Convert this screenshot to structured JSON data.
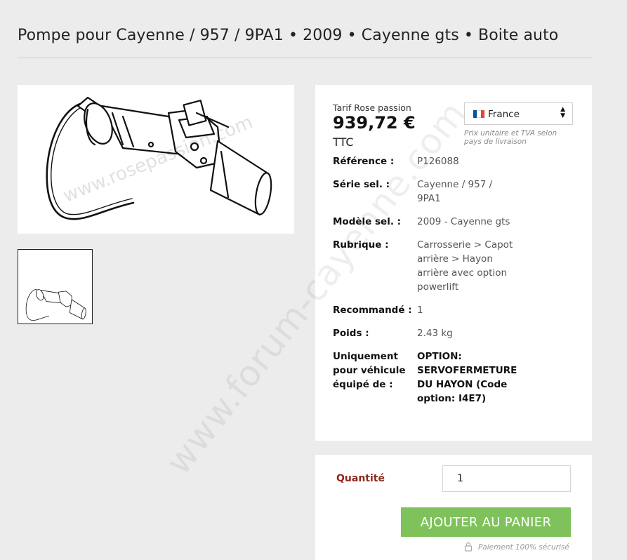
{
  "page": {
    "title": "Pompe pour Cayenne / 957 / 9PA1 • 2009 • Cayenne gts • Boite auto"
  },
  "images": {
    "main_alt": "Pompe",
    "image_watermark": "www.rosepassion.com"
  },
  "pricing": {
    "tarif_label": "Tarif Rose passion",
    "price": "939,72 €",
    "tax_label": "TTC"
  },
  "country": {
    "selected": "France",
    "note": "Prix unitaire et TVA selon pays de livraison",
    "flag_colors": [
      "#0055a4",
      "#ffffff",
      "#ef4135"
    ]
  },
  "specs": [
    {
      "label": "Référence :",
      "value": "P126088",
      "bold": false
    },
    {
      "label": "Série sel. :",
      "value": "Cayenne / 957 / 9PA1",
      "bold": false
    },
    {
      "label": "Modèle sel. :",
      "value": "2009 - Cayenne gts",
      "bold": false
    },
    {
      "label": "Rubrique :",
      "value": "Carrosserie > Capot arrière > Hayon arrière avec option powerlift",
      "bold": false
    },
    {
      "label": "Recommandé :",
      "value": "1",
      "bold": false
    },
    {
      "label": "Poids :",
      "value": "2.43 kg",
      "bold": false
    },
    {
      "label": "Uniquement pour véhicule équipé de :",
      "value": "OPTION: SERVOFERMETURE DU HAYON (Code option: I4E7)",
      "bold": true
    }
  ],
  "cart": {
    "quantity_label": "Quantité",
    "quantity_value": "1",
    "add_button_label": "AJOUTER AU PANIER",
    "secure_note": "Paiement 100% sécurisé",
    "button_color": "#7fc25b"
  },
  "watermark": {
    "text": "www.forum-cayenne.com"
  }
}
